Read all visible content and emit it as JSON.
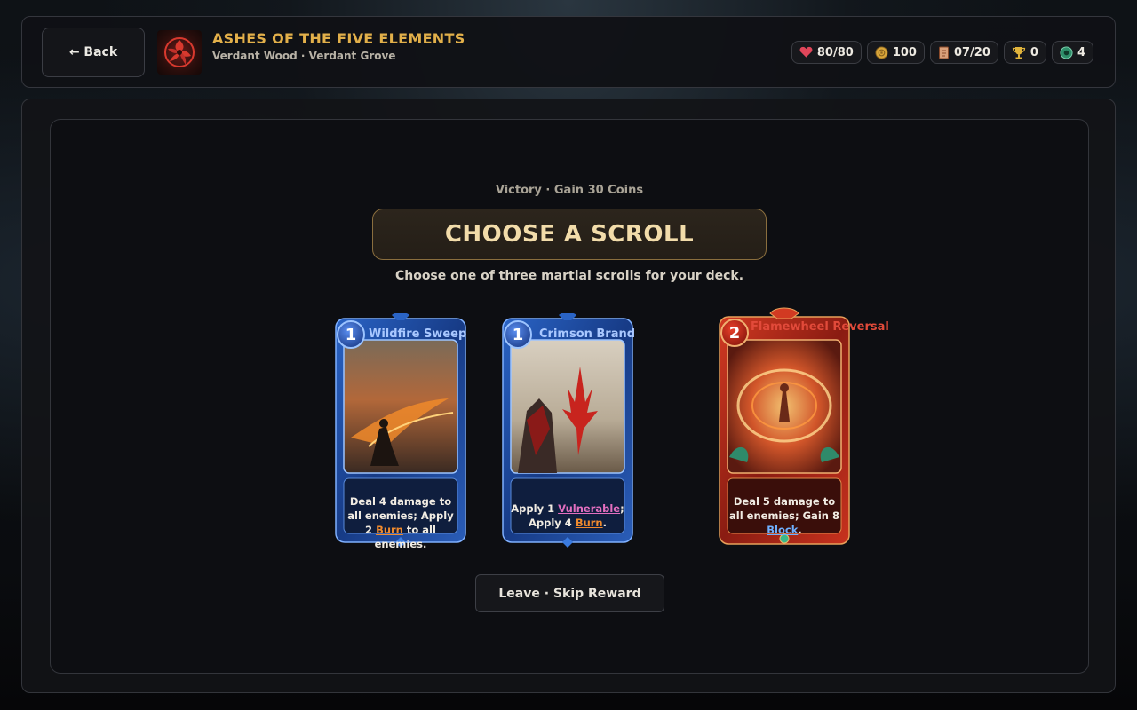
{
  "header": {
    "back_label": "← Back",
    "game_title": "ASHES OF THE FIVE ELEMENTS",
    "location": "Verdant Wood · Verdant Grove"
  },
  "stats": {
    "hp": "80/80",
    "coins": "100",
    "scrolls": "07/20",
    "trophies": "0",
    "jade": "4"
  },
  "reward": {
    "kicker": "Victory · Gain 30 Coins",
    "heading": "CHOOSE A SCROLL",
    "description": "Choose one of three martial scrolls for your deck.",
    "leave_label": "Leave · Skip Reward"
  },
  "cards": [
    {
      "cost": "1",
      "name": "Wildfire Sweep",
      "element": "water",
      "text_a": "Deal 4 damage to all enemies; Apply 2 ",
      "kw1": "Burn",
      "text_b": " to all enemies."
    },
    {
      "cost": "1",
      "name": "Crimson Brand",
      "element": "water",
      "text_a": "Apply 1 ",
      "kw1": "Vulnerable",
      "text_b": "; Apply 4 ",
      "kw2": "Burn",
      "text_c": "."
    },
    {
      "cost": "2",
      "name": "Flamewheel Reversal",
      "element": "fire",
      "text_a": "Deal 5 damage to all enemies; Gain 8 ",
      "kw1": "Block",
      "text_b": "."
    }
  ],
  "colors": {
    "gold": "#e2b04a",
    "blue_frame": "#1d4ea8",
    "red_frame": "#b8281a",
    "burn": "#ef8a2e",
    "vulnerable": "#e36fc0",
    "block": "#6fb0ff"
  }
}
